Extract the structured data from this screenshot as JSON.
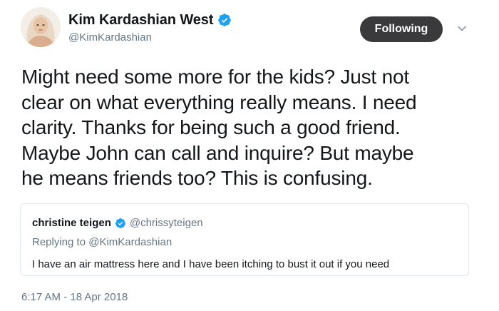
{
  "tweet": {
    "author": {
      "display_name": "Kim Kardashian West",
      "handle": "@KimKardashian",
      "verified": true
    },
    "follow_button_label": "Following",
    "text": "Might need some more for the kids? Just not\nclear on what everything really means. I need\nclarity. Thanks for being such a good friend.\nMaybe John can call and inquire? But maybe\nhe means friends too? This is confusing.",
    "timestamp": "6:17 AM - 18 Apr 2018"
  },
  "quoted_tweet": {
    "display_name": "christine teigen",
    "handle": "@chrissyteigen",
    "verified": true,
    "replying_prefix": "Replying to",
    "replying_to": "@KimKardashian",
    "text": "I have an air mattress here and I have been itching to bust it out if you need"
  },
  "colors": {
    "verified_blue": "#1da1f2",
    "button_bg": "#3a3a3c",
    "secondary_text": "#657786",
    "primary_text": "#14171a",
    "border": "#e1e8ed"
  },
  "icons": {
    "verified": "verified-badge-icon",
    "caret": "chevron-down-icon",
    "avatar": "profile-photo"
  }
}
